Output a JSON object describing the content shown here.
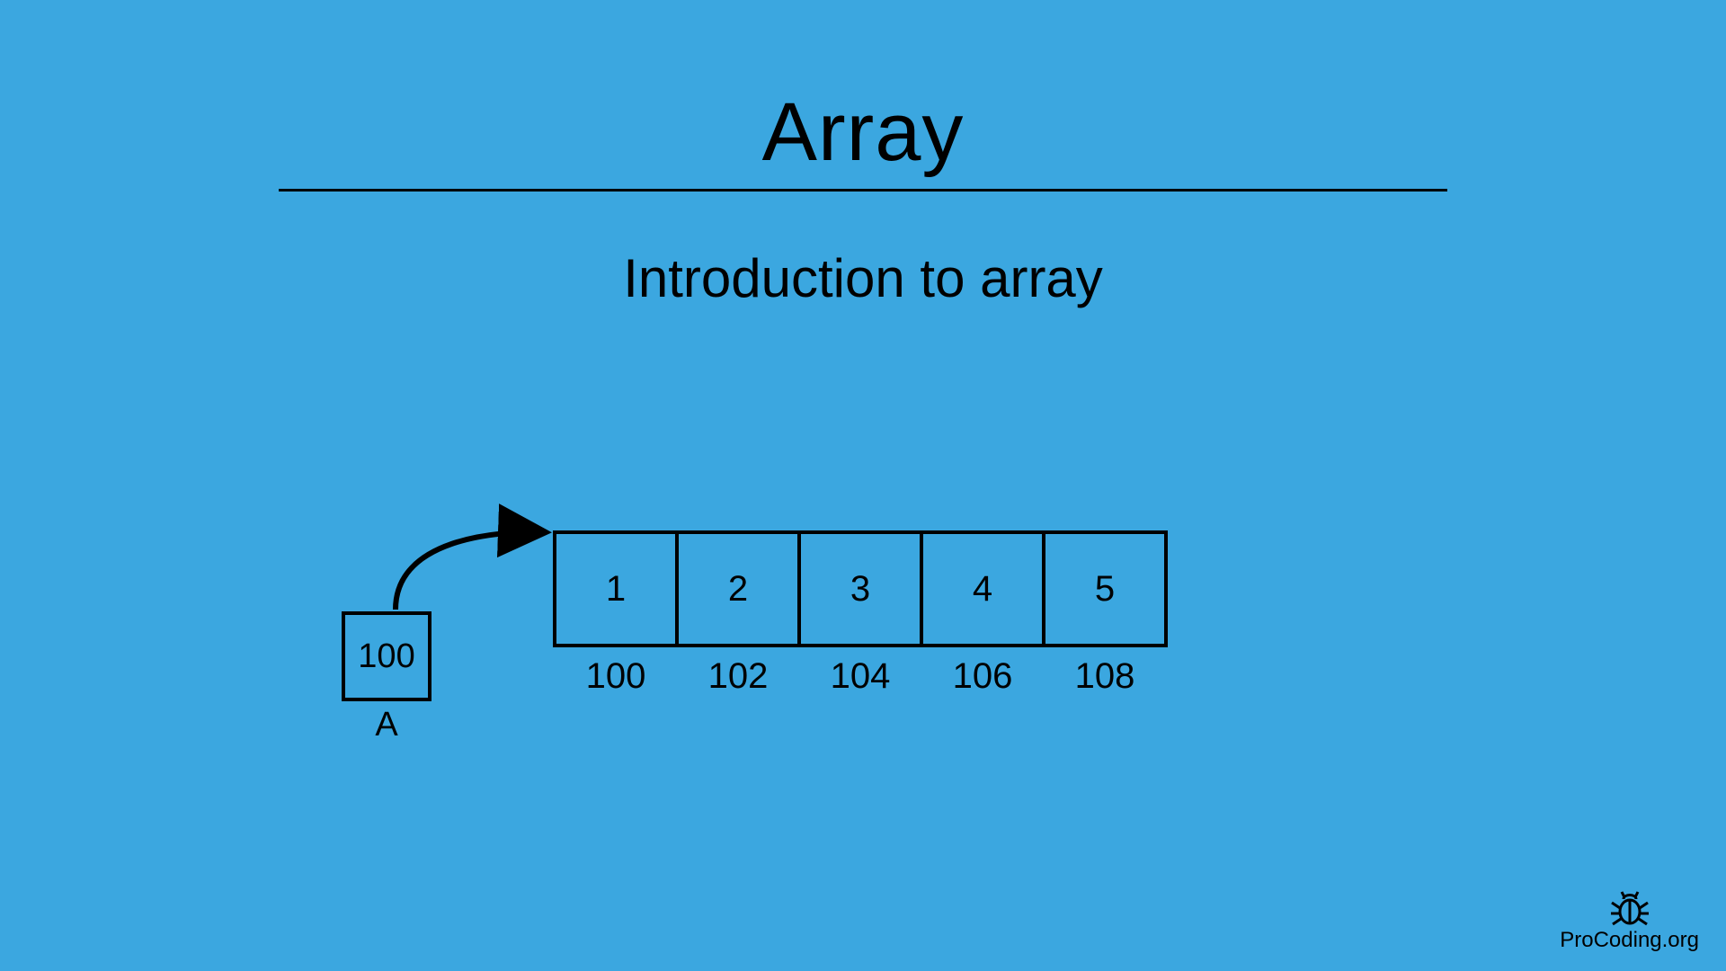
{
  "title": "Array",
  "subtitle": "Introduction to array",
  "pointer": {
    "value": "100",
    "label": "A"
  },
  "cells": [
    "1",
    "2",
    "3",
    "4",
    "5"
  ],
  "addresses": [
    "100",
    "102",
    "104",
    "106",
    "108"
  ],
  "brand": "ProCoding.org"
}
